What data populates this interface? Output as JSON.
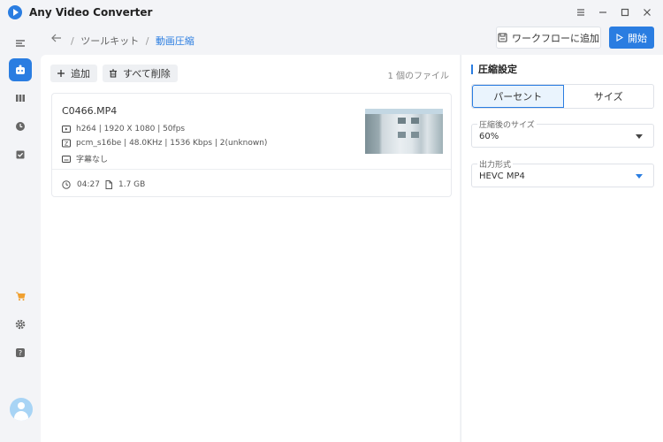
{
  "app": {
    "title": "Any Video Converter"
  },
  "window_controls": [
    "menu-icon",
    "minimize-icon",
    "maximize-icon",
    "close-icon"
  ],
  "breadcrumb": {
    "items": [
      "ツールキット",
      "動画圧縮"
    ],
    "separator": "/"
  },
  "header": {
    "workflow_label": "ワークフローに追加",
    "start_label": "開始"
  },
  "toolbar": {
    "add_label": "追加",
    "delete_all_label": "すべて削除",
    "file_count": "1 個のファイル"
  },
  "file": {
    "name": "C0466.MP4",
    "video": "h264 | 1920 X 1080 | 50fps",
    "audio": "pcm_s16be | 48.0KHz | 1536 Kbps | 2(unknown)",
    "subtitle": "字幕なし",
    "duration": "04:27",
    "size": "1.7 GB"
  },
  "settings": {
    "title": "圧縮設定",
    "modes": [
      "パーセント",
      "サイズ"
    ],
    "active_mode": "パーセント",
    "size_label": "圧縮後のサイズ",
    "size_value": "60%",
    "format_label": "出力形式",
    "format_value": "HEVC MP4"
  },
  "sidebar": {
    "items": [
      "toolbox-icon",
      "library-icon",
      "history-icon",
      "task-icon",
      "cart-icon",
      "gear-icon",
      "help-icon",
      "avatar"
    ],
    "active": "toolbox-icon"
  },
  "colors": {
    "accent": "#2a7de1",
    "cart": "#f0a030",
    "background": "#f3f4f7"
  }
}
